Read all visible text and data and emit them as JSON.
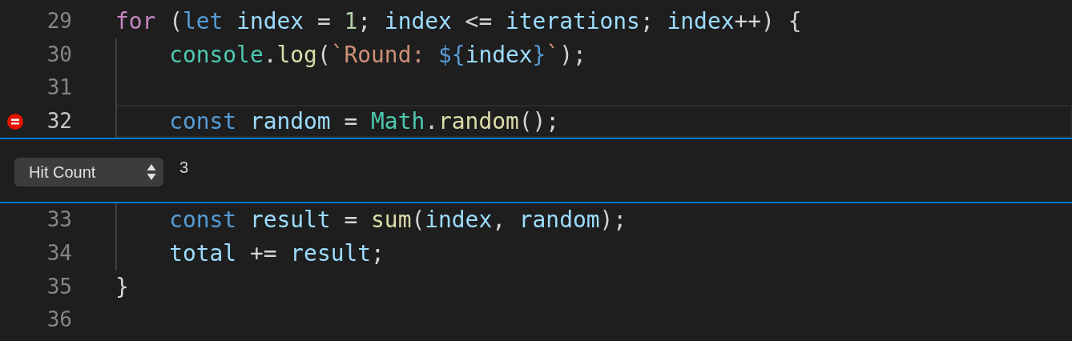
{
  "editor": {
    "lines_before": [
      {
        "number": "29",
        "current": false,
        "indent_guide": false,
        "tokens": [
          {
            "text": "for",
            "kind": "control"
          },
          {
            "text": " (",
            "kind": "punct"
          },
          {
            "text": "let",
            "kind": "storage"
          },
          {
            "text": " index",
            "kind": "variable"
          },
          {
            "text": " = ",
            "kind": "punct"
          },
          {
            "text": "1",
            "kind": "number"
          },
          {
            "text": "; ",
            "kind": "punct"
          },
          {
            "text": "index",
            "kind": "variable"
          },
          {
            "text": " <= ",
            "kind": "punct"
          },
          {
            "text": "iterations",
            "kind": "variable"
          },
          {
            "text": "; ",
            "kind": "punct"
          },
          {
            "text": "index",
            "kind": "variable"
          },
          {
            "text": "++) {",
            "kind": "punct"
          }
        ]
      },
      {
        "number": "30",
        "current": false,
        "indent_guide": true,
        "tokens": [
          {
            "text": "    console",
            "kind": "class"
          },
          {
            "text": ".",
            "kind": "punct"
          },
          {
            "text": "log",
            "kind": "function"
          },
          {
            "text": "(",
            "kind": "punct"
          },
          {
            "text": "`Round: ",
            "kind": "string"
          },
          {
            "text": "${",
            "kind": "storage"
          },
          {
            "text": "index",
            "kind": "variable"
          },
          {
            "text": "}",
            "kind": "storage"
          },
          {
            "text": "`",
            "kind": "string"
          },
          {
            "text": ");",
            "kind": "punct"
          }
        ]
      },
      {
        "number": "31",
        "current": false,
        "indent_guide": true
      },
      {
        "number": "32",
        "current": true,
        "indent_guide": true,
        "breakpoint": {
          "kind": "conditional"
        },
        "tokens": [
          {
            "text": "    const",
            "kind": "storage"
          },
          {
            "text": " random",
            "kind": "variable"
          },
          {
            "text": " = ",
            "kind": "punct"
          },
          {
            "text": "Math",
            "kind": "class"
          },
          {
            "text": ".",
            "kind": "punct"
          },
          {
            "text": "random",
            "kind": "function"
          },
          {
            "text": "();",
            "kind": "punct"
          }
        ]
      }
    ],
    "breakpoint_widget": {
      "condition_type": "Hit Count",
      "value": "3"
    },
    "lines_after": [
      {
        "number": "33",
        "current": false,
        "indent_guide": true,
        "tokens": [
          {
            "text": "    const",
            "kind": "storage"
          },
          {
            "text": " result",
            "kind": "variable"
          },
          {
            "text": " = ",
            "kind": "punct"
          },
          {
            "text": "sum",
            "kind": "function"
          },
          {
            "text": "(",
            "kind": "punct"
          },
          {
            "text": "index",
            "kind": "variable"
          },
          {
            "text": ", ",
            "kind": "punct"
          },
          {
            "text": "random",
            "kind": "variable"
          },
          {
            "text": ");",
            "kind": "punct"
          }
        ]
      },
      {
        "number": "34",
        "current": false,
        "indent_guide": true,
        "tokens": [
          {
            "text": "    total",
            "kind": "variable"
          },
          {
            "text": " += ",
            "kind": "punct"
          },
          {
            "text": "result",
            "kind": "variable"
          },
          {
            "text": ";",
            "kind": "punct"
          }
        ]
      },
      {
        "number": "35",
        "current": false,
        "indent_guide": false,
        "tokens": [
          {
            "text": "}",
            "kind": "punct"
          }
        ]
      },
      {
        "number": "36",
        "current": false,
        "indent_guide": false
      }
    ]
  }
}
